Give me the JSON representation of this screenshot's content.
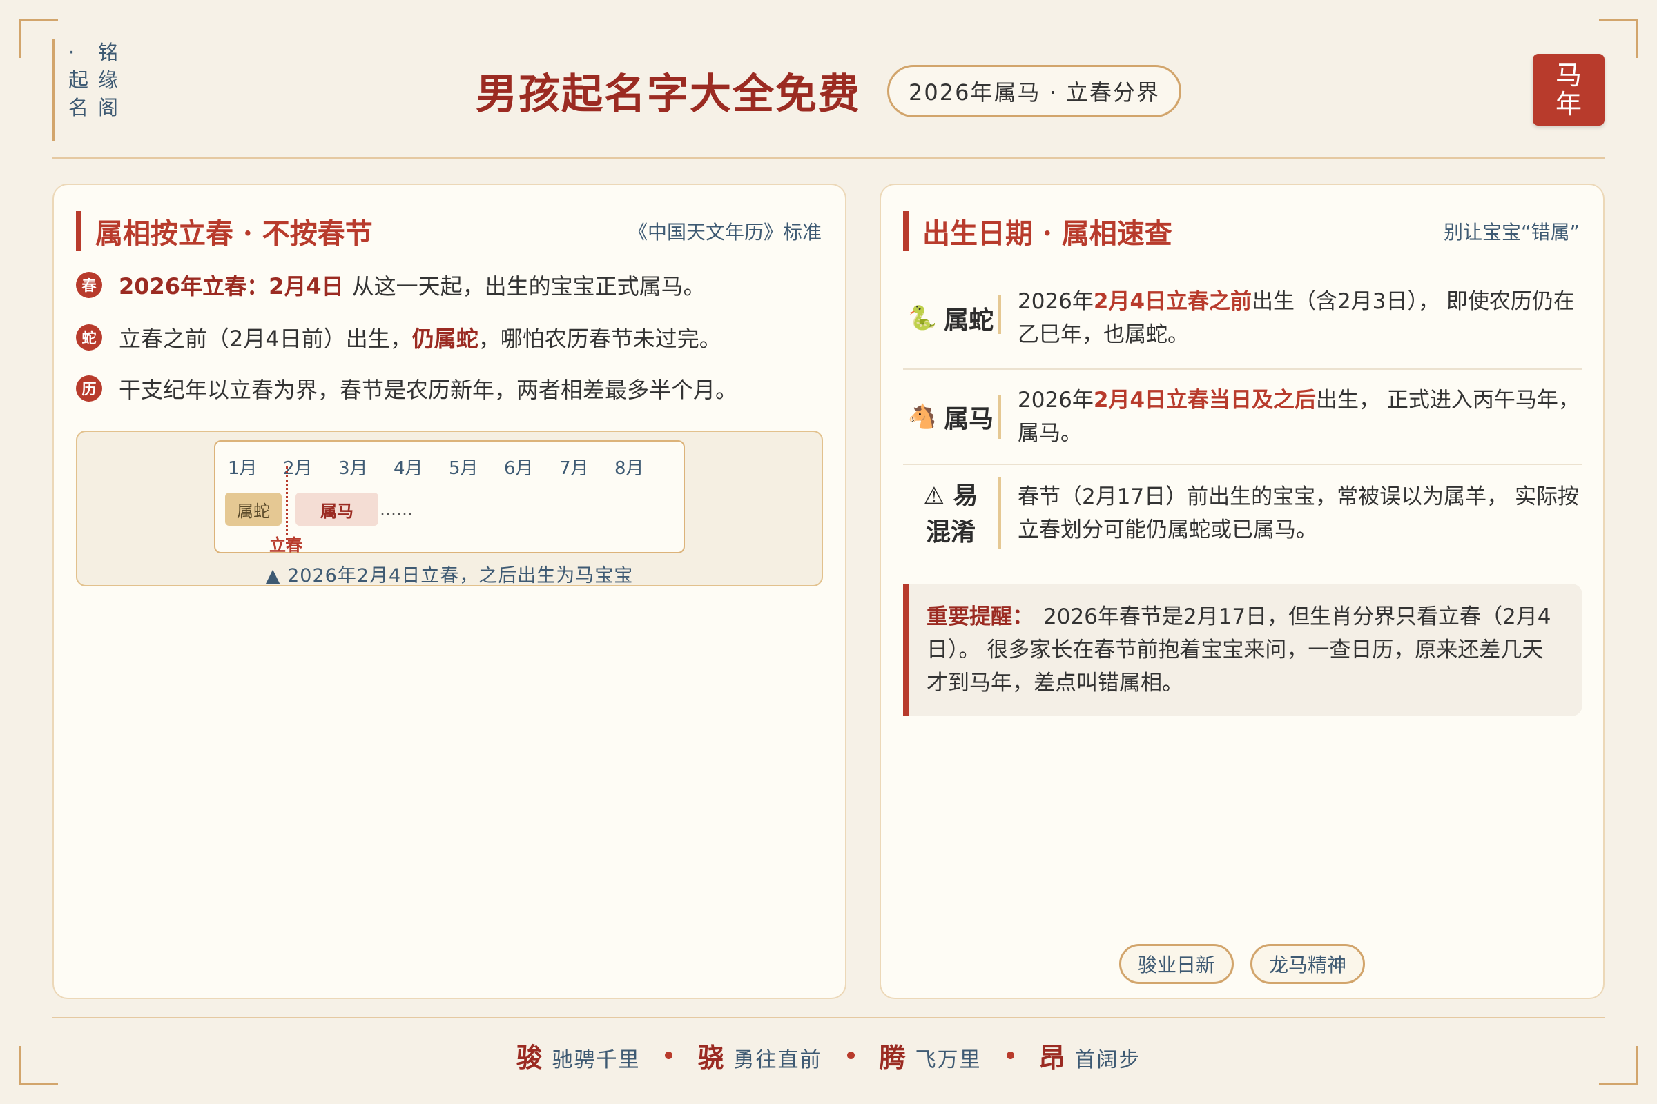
{
  "brand": {
    "col1": [
      "·",
      "起",
      "名"
    ],
    "col2": [
      "铭",
      "缘",
      "阁"
    ]
  },
  "header": {
    "title": "男孩起名字大全免费",
    "pill": "2026年属马 · 立春分界",
    "badge": [
      "马",
      "年"
    ]
  },
  "left": {
    "title": "属相按立春 · 不按春节",
    "note": "《中国天文年历》标准",
    "facts": [
      {
        "icon": "春",
        "strong": "2026年立春：2月4日",
        "text": "从这一天起，出生的宝宝正式属马。"
      },
      {
        "icon": "蛇",
        "pre": "立春之前（2月4日前）出生，",
        "strong": "仍属蛇",
        "post": "，哪怕农历春节未过完。"
      },
      {
        "icon": "历",
        "text": "干支纪年以立春为界，春节是农历新年，两者相差最多半个月。"
      }
    ],
    "timeline": {
      "months": [
        "1月",
        "2月",
        "3月",
        "4月",
        "5月",
        "6月",
        "7月",
        "8月"
      ],
      "snake": "属蛇",
      "horse": "属马",
      "dots": "……",
      "marker": "立春",
      "caption": "▲ 2026年2月4日立春，之后出生为马宝宝"
    }
  },
  "right": {
    "title": "出生日期 · 属相速查",
    "note": "别让宝宝“错属”",
    "rows": [
      {
        "icon": "🐍",
        "label": "属蛇",
        "pre": "2026年",
        "hl": "2月4日立春之前",
        "post": "出生（含2月3日）， 即使农历仍在乙巳年，也属蛇。"
      },
      {
        "icon": "🐴",
        "label": "属马",
        "pre": "2026年",
        "hl": "2月4日立春当日及之后",
        "post": "出生， 正式进入丙午马年，属马。"
      },
      {
        "icon": "⚠",
        "label1": "易",
        "label2": "混淆",
        "text": "春节（2月17日）前出生的宝宝，常被误以为属羊， 实际按立春划分可能仍属蛇或已属马。"
      }
    ],
    "reminder": {
      "label": "重要提醒：",
      "text": "2026年春节是2月17日，但生肖分界只看立春（2月4日）。 很多家长在春节前抱着宝宝来问，一查日历，原来还差几天才到马年，差点叫错属相。"
    },
    "tags": [
      "骏业日新",
      "龙马精神"
    ]
  },
  "footer": [
    {
      "char": "骏",
      "text": "驰骋千里"
    },
    {
      "char": "骁",
      "text": "勇往直前"
    },
    {
      "char": "腾",
      "text": "飞万里"
    },
    {
      "char": "昂",
      "text": "首阔步"
    }
  ]
}
